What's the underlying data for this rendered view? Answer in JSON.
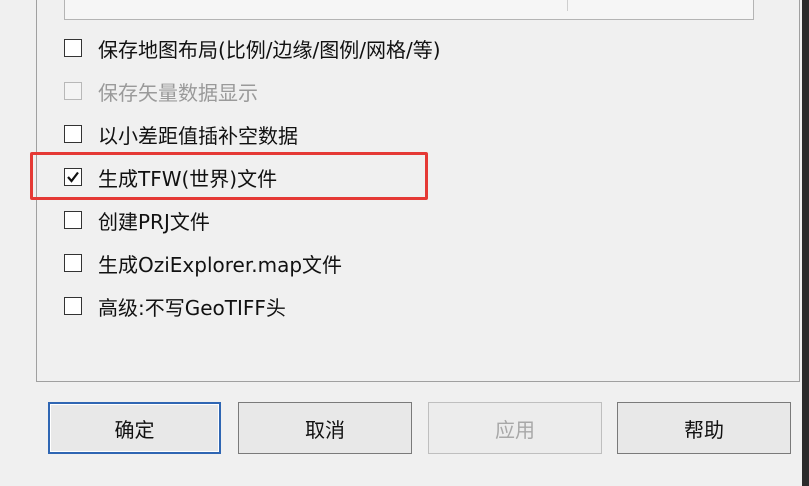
{
  "options": [
    {
      "label": "保存地图布局(比例/边缘/图例/网格/等)",
      "checked": false,
      "disabled": false
    },
    {
      "label": "保存矢量数据显示",
      "checked": false,
      "disabled": true
    },
    {
      "label": "以小差距值插补空数据",
      "checked": false,
      "disabled": false
    },
    {
      "label": "生成TFW(世界)文件",
      "checked": true,
      "disabled": false
    },
    {
      "label": "创建PRJ文件",
      "checked": false,
      "disabled": false
    },
    {
      "label": "生成OziExplorer.map文件",
      "checked": false,
      "disabled": false
    },
    {
      "label": "高级:不写GeoTIFF头",
      "checked": false,
      "disabled": false
    }
  ],
  "buttons": {
    "ok": "确定",
    "cancel": "取消",
    "apply": "应用",
    "help": "帮助"
  },
  "colors": {
    "highlight": "#e53935",
    "default_button_border": "#2f66b3"
  }
}
